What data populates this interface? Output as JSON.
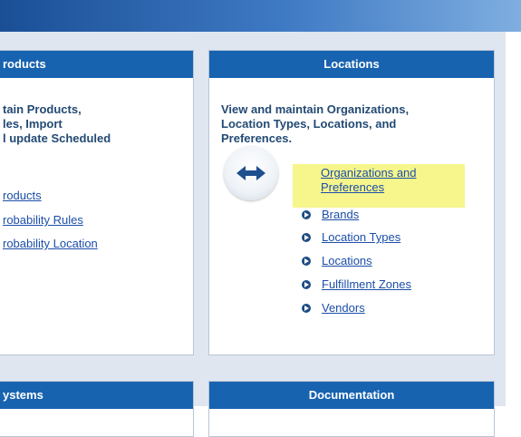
{
  "products_panel": {
    "header": "roducts",
    "desc_lines": [
      "tain Products,",
      "les, Import",
      "l update Scheduled"
    ],
    "links": [
      "roducts",
      "robability Rules",
      "robability Location"
    ]
  },
  "locations_panel": {
    "header": "Locations",
    "desc_lines": [
      "View and maintain Organizations,",
      "Location Types, Locations, and",
      "Preferences."
    ],
    "links": [
      {
        "line1": "Organizations and",
        "line2": "Preferences"
      },
      {
        "label": "Brands"
      },
      {
        "label": "Location Types"
      },
      {
        "label": "Locations"
      },
      {
        "label": "Fulfillment Zones"
      },
      {
        "label": "Vendors"
      }
    ],
    "icon": "left-right-arrow-icon"
  },
  "systems_panel": {
    "header": "ystems"
  },
  "documentation_panel": {
    "header": "Documentation"
  },
  "colors": {
    "header_bg": "#1863b0",
    "link": "#1c4ea8",
    "highlight": "#f6f68c",
    "background": "#dfe6ef"
  }
}
